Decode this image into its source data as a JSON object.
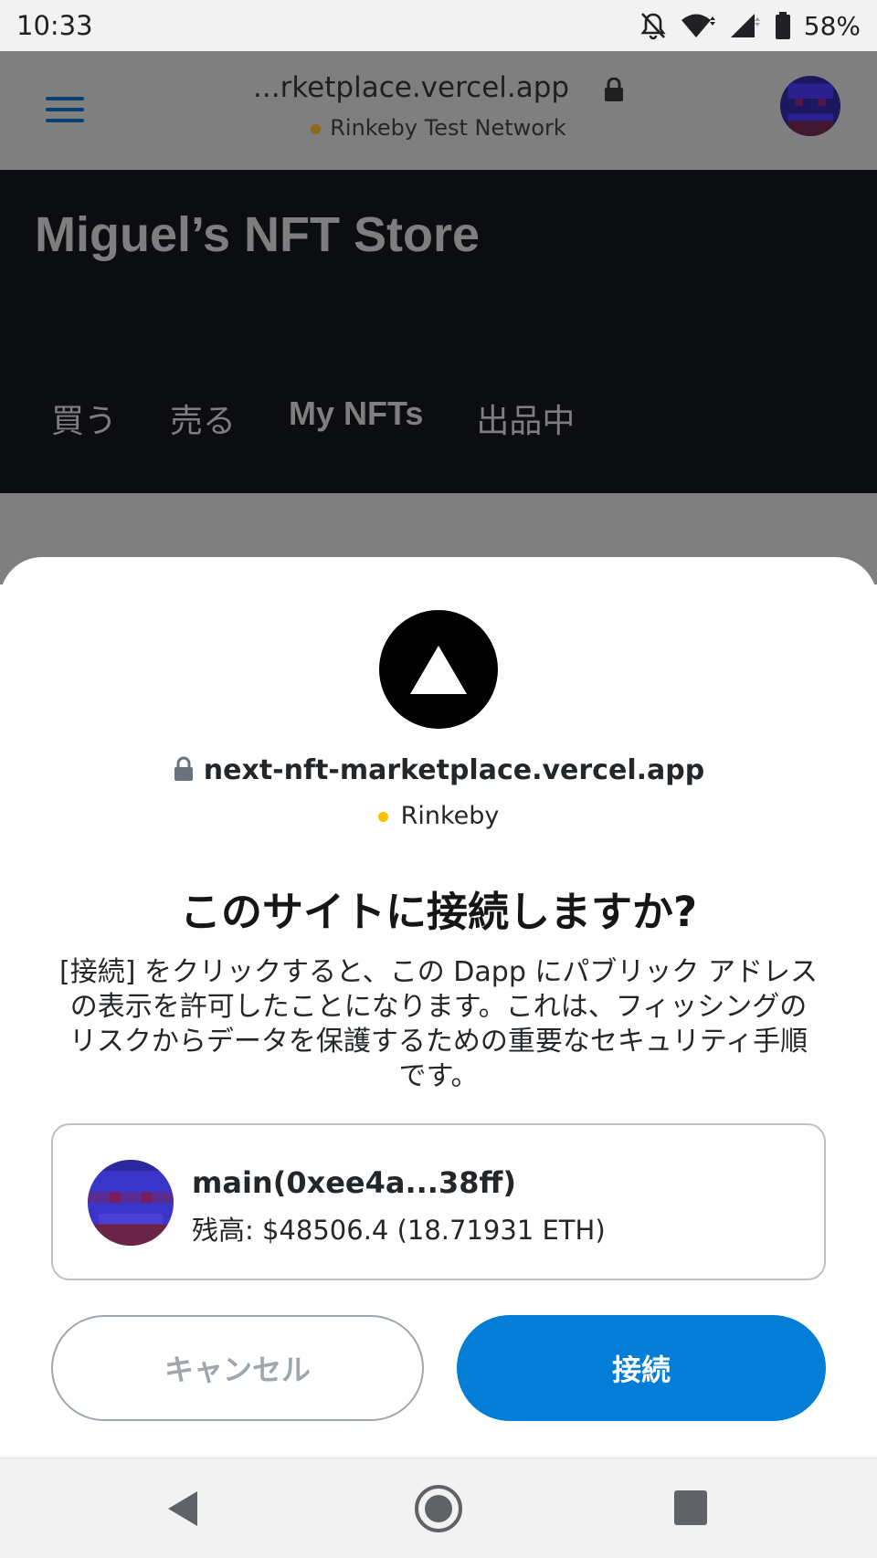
{
  "status_bar": {
    "time": "10:33",
    "battery": "58%"
  },
  "browser": {
    "url": "...rketplace.vercel.app",
    "network": "Rinkeby Test Network"
  },
  "page": {
    "title": "Miguel’s NFT Store",
    "tabs": [
      "買う",
      "売る",
      "My NFTs",
      "出品中"
    ]
  },
  "connect_sheet": {
    "domain": "next-nft-marketplace.vercel.app",
    "network": "Rinkeby",
    "title": "このサイトに接続しますか?",
    "description": "[接続] をクリックすると、この Dapp にパブリック アドレスの表示を許可したことになります。これは、フィッシングのリスクからデータを保護するための重要なセキュリティ手順です。",
    "account": {
      "name": "main(0xee4a...38ff)",
      "balance": "残高: $48506.4 (18.71931 ETH)"
    },
    "cancel_label": "キャンセル",
    "connect_label": "接続"
  },
  "colors": {
    "primary": "#037dd6",
    "network_dot": "#f8c000"
  }
}
